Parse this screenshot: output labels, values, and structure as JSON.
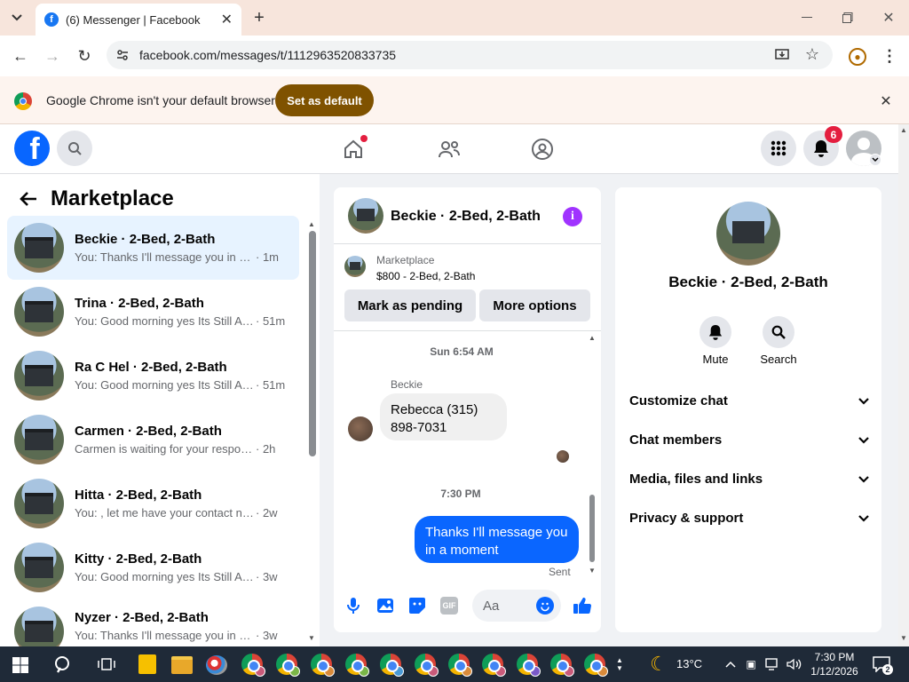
{
  "browser": {
    "tab_title": "(6) Messenger | Facebook",
    "url": "facebook.com/messages/t/1112963520833735",
    "new_tab_icon": "plus-icon",
    "infobar_text": "Google Chrome isn't your default browser",
    "set_default_label": "Set as default"
  },
  "header": {
    "notification_count": "6"
  },
  "marketplace": {
    "title": "Marketplace",
    "conversations": [
      {
        "name": "Beckie · 2-Bed, 2-Bath",
        "preview": "You: Thanks I'll message you in a ...",
        "time": "· 1m"
      },
      {
        "name": "Trina · 2-Bed, 2-Bath",
        "preview": "You: Good morning yes Its Still Av...",
        "time": "· 51m"
      },
      {
        "name": "Ra C Hel · 2-Bed, 2-Bath",
        "preview": "You: Good morning yes Its Still Av...",
        "time": "· 51m"
      },
      {
        "name": "Carmen · 2-Bed, 2-Bath",
        "preview": "Carmen is waiting for your response.",
        "time": "· 2h"
      },
      {
        "name": "Hitta · 2-Bed, 2-Bath",
        "preview": "You: , let me have your contact nu...",
        "time": "· 2w"
      },
      {
        "name": "Kitty · 2-Bed, 2-Bath",
        "preview": "You: Good morning yes Its Still Ava...",
        "time": "· 3w"
      },
      {
        "name": "Nyzer · 2-Bed, 2-Bath",
        "preview": "You: Thanks I'll message you in a ...",
        "time": "· 3w"
      }
    ]
  },
  "chat": {
    "title": "Beckie · 2-Bed, 2-Bath",
    "listing_label": "Marketplace",
    "listing_desc": "$800 - 2-Bed, 2-Bath",
    "mark_pending": "Mark as pending",
    "more_options": "More options",
    "timestamp1": "Sun 6:54 AM",
    "sender": "Beckie",
    "incoming_message": "Rebecca (315) 898-7031",
    "timestamp2": "7:30 PM",
    "outgoing_message": "Thanks I'll message you in a moment",
    "status": "Sent",
    "composer_placeholder": "Aa"
  },
  "info_panel": {
    "title": "Beckie · 2-Bed, 2-Bath",
    "mute_label": "Mute",
    "search_label": "Search",
    "sections": [
      "Customize chat",
      "Chat members",
      "Media, files and links",
      "Privacy & support"
    ]
  },
  "taskbar": {
    "weather": "13°C",
    "time": "7:30 PM",
    "date": "1/12/2026",
    "notification_count": "2"
  },
  "colors": {
    "accent": "#0866ff",
    "brand": "#1877f2",
    "infobar_button": "#7f5200"
  }
}
